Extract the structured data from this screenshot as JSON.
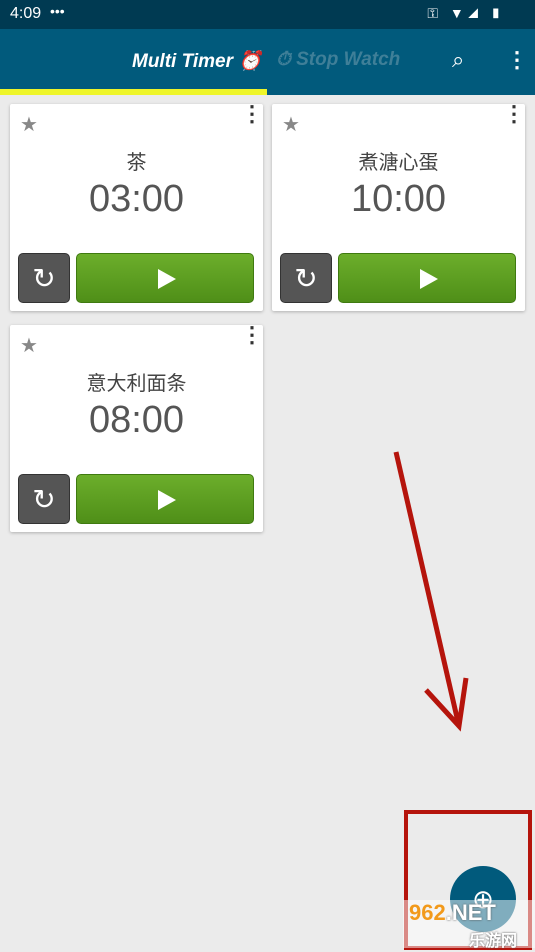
{
  "status": {
    "time": "4:09",
    "dots": "•••",
    "icons": "⚿ ▼◢ ▮"
  },
  "appbar": {
    "tab1": "Multi Timer",
    "tab2": "Stop Watch",
    "search_icon": "search-icon",
    "more_icon": "more-vert-icon"
  },
  "timers": [
    {
      "name": "茶",
      "time": "03:00"
    },
    {
      "name": "煮溏心蛋",
      "time": "10:00"
    },
    {
      "name": "意大利面条",
      "time": "08:00"
    }
  ],
  "fab": {
    "icon": "add-alarm-icon"
  },
  "watermark": {
    "num": "962",
    "net": ".NET",
    "cn": "乐游网"
  },
  "colors": {
    "appbar": "#015a7c",
    "indicator": "#eef529",
    "play": "#5a9e20",
    "annotation": "#b5140c"
  }
}
